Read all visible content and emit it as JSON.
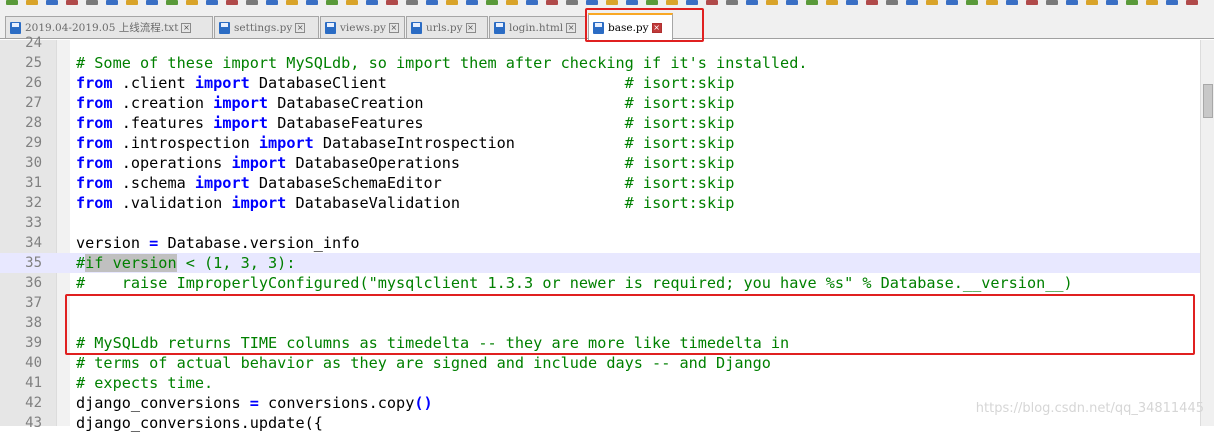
{
  "tabs": [
    {
      "label": "2019.04-2019.05 上线流程.txt",
      "active": false
    },
    {
      "label": "settings.py",
      "active": false
    },
    {
      "label": "views.py",
      "active": false
    },
    {
      "label": "urls.py",
      "active": false
    },
    {
      "label": "login.html",
      "active": false
    },
    {
      "label": "base.py",
      "active": true
    }
  ],
  "colors": {
    "comment": "#008000",
    "keyword": "#0000ff",
    "highlight_box": "#e02020",
    "caret_line": "#e8e8ff"
  },
  "lines": [
    {
      "num": "24",
      "segs": []
    },
    {
      "num": "25",
      "segs": [
        {
          "t": "# Some of these import MySQLdb, so import them after checking if it's installed.",
          "c": "cm"
        }
      ]
    },
    {
      "num": "26",
      "segs": [
        {
          "t": "from",
          "c": "kw"
        },
        {
          "t": " .client "
        },
        {
          "t": "import",
          "c": "kw"
        },
        {
          "t": " DatabaseClient                          "
        },
        {
          "t": "# isort:skip",
          "c": "cm"
        }
      ]
    },
    {
      "num": "27",
      "segs": [
        {
          "t": "from",
          "c": "kw"
        },
        {
          "t": " .creation "
        },
        {
          "t": "import",
          "c": "kw"
        },
        {
          "t": " DatabaseCreation                      "
        },
        {
          "t": "# isort:skip",
          "c": "cm"
        }
      ]
    },
    {
      "num": "28",
      "segs": [
        {
          "t": "from",
          "c": "kw"
        },
        {
          "t": " .features "
        },
        {
          "t": "import",
          "c": "kw"
        },
        {
          "t": " DatabaseFeatures                      "
        },
        {
          "t": "# isort:skip",
          "c": "cm"
        }
      ]
    },
    {
      "num": "29",
      "segs": [
        {
          "t": "from",
          "c": "kw"
        },
        {
          "t": " .introspection "
        },
        {
          "t": "import",
          "c": "kw"
        },
        {
          "t": " DatabaseIntrospection            "
        },
        {
          "t": "# isort:skip",
          "c": "cm"
        }
      ]
    },
    {
      "num": "30",
      "segs": [
        {
          "t": "from",
          "c": "kw"
        },
        {
          "t": " .operations "
        },
        {
          "t": "import",
          "c": "kw"
        },
        {
          "t": " DatabaseOperations                  "
        },
        {
          "t": "# isort:skip",
          "c": "cm"
        }
      ]
    },
    {
      "num": "31",
      "segs": [
        {
          "t": "from",
          "c": "kw"
        },
        {
          "t": " .schema "
        },
        {
          "t": "import",
          "c": "kw"
        },
        {
          "t": " DatabaseSchemaEditor                    "
        },
        {
          "t": "# isort:skip",
          "c": "cm"
        }
      ]
    },
    {
      "num": "32",
      "segs": [
        {
          "t": "from",
          "c": "kw"
        },
        {
          "t": " .validation "
        },
        {
          "t": "import",
          "c": "kw"
        },
        {
          "t": " DatabaseValidation                  "
        },
        {
          "t": "# isort:skip",
          "c": "cm"
        }
      ]
    },
    {
      "num": "33",
      "segs": []
    },
    {
      "num": "34",
      "segs": [
        {
          "t": "version "
        },
        {
          "t": "=",
          "c": "kw"
        },
        {
          "t": " Database.version_info"
        }
      ]
    },
    {
      "num": "35",
      "caret": true,
      "segs": [
        {
          "t": "#",
          "c": "cm"
        },
        {
          "t": "if version",
          "c": "cm sel"
        },
        {
          "t": " < (1, 3, 3):",
          "c": "cm"
        }
      ]
    },
    {
      "num": "36",
      "segs": [
        {
          "t": "#    raise ImproperlyConfigured(\"mysqlclient 1.3.3 or newer is required; you have %s\" % Database.__version__)",
          "c": "cm"
        }
      ]
    },
    {
      "num": "37",
      "segs": []
    },
    {
      "num": "38",
      "segs": []
    },
    {
      "num": "39",
      "segs": [
        {
          "t": "# MySQLdb returns TIME columns as timedelta -- they are more like timedelta in",
          "c": "cm"
        }
      ]
    },
    {
      "num": "40",
      "segs": [
        {
          "t": "# terms of actual behavior as they are signed and include days -- and Django",
          "c": "cm"
        }
      ]
    },
    {
      "num": "41",
      "segs": [
        {
          "t": "# expects time.",
          "c": "cm"
        }
      ]
    },
    {
      "num": "42",
      "segs": [
        {
          "t": "django_conversions "
        },
        {
          "t": "=",
          "c": "kw"
        },
        {
          "t": " conversions.copy"
        },
        {
          "t": "()",
          "c": "paren"
        }
      ]
    },
    {
      "num": "43",
      "segs": [
        {
          "t": "django_conversions.update({",
          "c": ""
        }
      ]
    }
  ],
  "watermark": "https://blog.csdn.net/qq_34811445"
}
